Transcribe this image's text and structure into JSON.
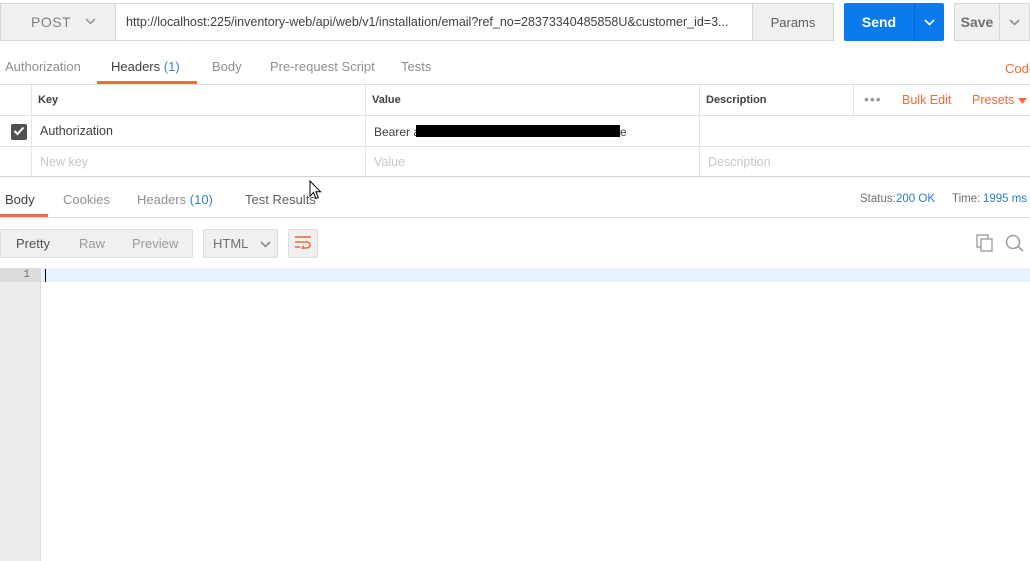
{
  "request": {
    "method": "POST",
    "url": "http://localhost:225/inventory-web/api/web/v1/installation/email?ref_no=28373340485858U&customer_id=3...",
    "params_label": "Params",
    "send_label": "Send",
    "save_label": "Save"
  },
  "request_tabs": {
    "authorization": "Authorization",
    "headers": "Headers",
    "headers_count": "(1)",
    "body": "Body",
    "pre_request": "Pre-request Script",
    "tests": "Tests",
    "code": "Code"
  },
  "headers_table": {
    "col_key": "Key",
    "col_value": "Value",
    "col_description": "Description",
    "bulk_edit": "Bulk Edit",
    "presets": "Presets",
    "rows": [
      {
        "checked": true,
        "key": "Authorization",
        "value_prefix": "Bearer a",
        "value_suffix": "e"
      }
    ],
    "new_row": {
      "key_placeholder": "New key",
      "value_placeholder": "Value",
      "description_placeholder": "Description"
    }
  },
  "response_tabs": {
    "body": "Body",
    "cookies": "Cookies",
    "headers": "Headers",
    "headers_count": "(10)",
    "test_results": "Test Results"
  },
  "response_status": {
    "status_label": "Status:",
    "status_value": "200 OK",
    "time_label": "Time:",
    "time_value": "1995 ms"
  },
  "view": {
    "pretty": "Pretty",
    "raw": "Raw",
    "preview": "Preview",
    "format": "HTML"
  },
  "editor": {
    "line_numbers": [
      "1"
    ]
  },
  "colors": {
    "accent": "#f26b3a",
    "send": "#097bed",
    "link": "#2f80c8"
  }
}
